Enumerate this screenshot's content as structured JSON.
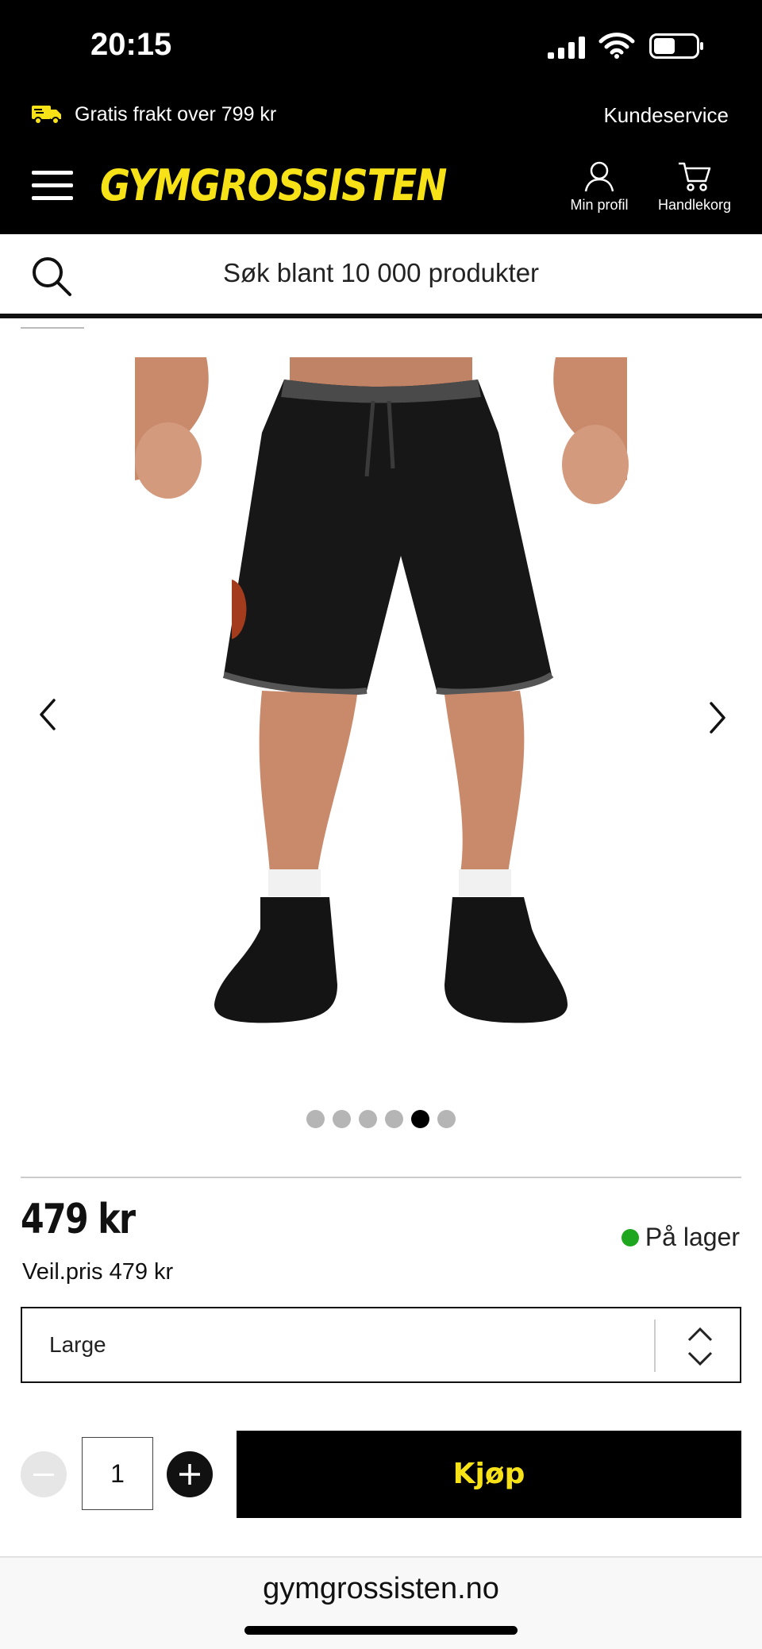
{
  "status_bar": {
    "time": "20:15"
  },
  "header": {
    "promo_text": "Gratis frakt over 799 kr",
    "customer_service": "Kundeservice",
    "logo": "GYMGROSSISTEN",
    "profile_label": "Min profil",
    "cart_label": "Handlekorg"
  },
  "search": {
    "placeholder": "Søk blant 10 000 produkter"
  },
  "gallery": {
    "total_images": 6,
    "active_index": 5
  },
  "product": {
    "price": "479 kr",
    "recommended_price": "Veil.pris 479 kr",
    "stock_status": "På lager",
    "stock_color": "#1fa61f",
    "size_selected": "Large",
    "quantity": "1",
    "buy_label": "Kjøp"
  },
  "browser": {
    "url": "gymgrossisten.no"
  },
  "colors": {
    "accent": "#f7e218",
    "header_bg": "#000000"
  }
}
